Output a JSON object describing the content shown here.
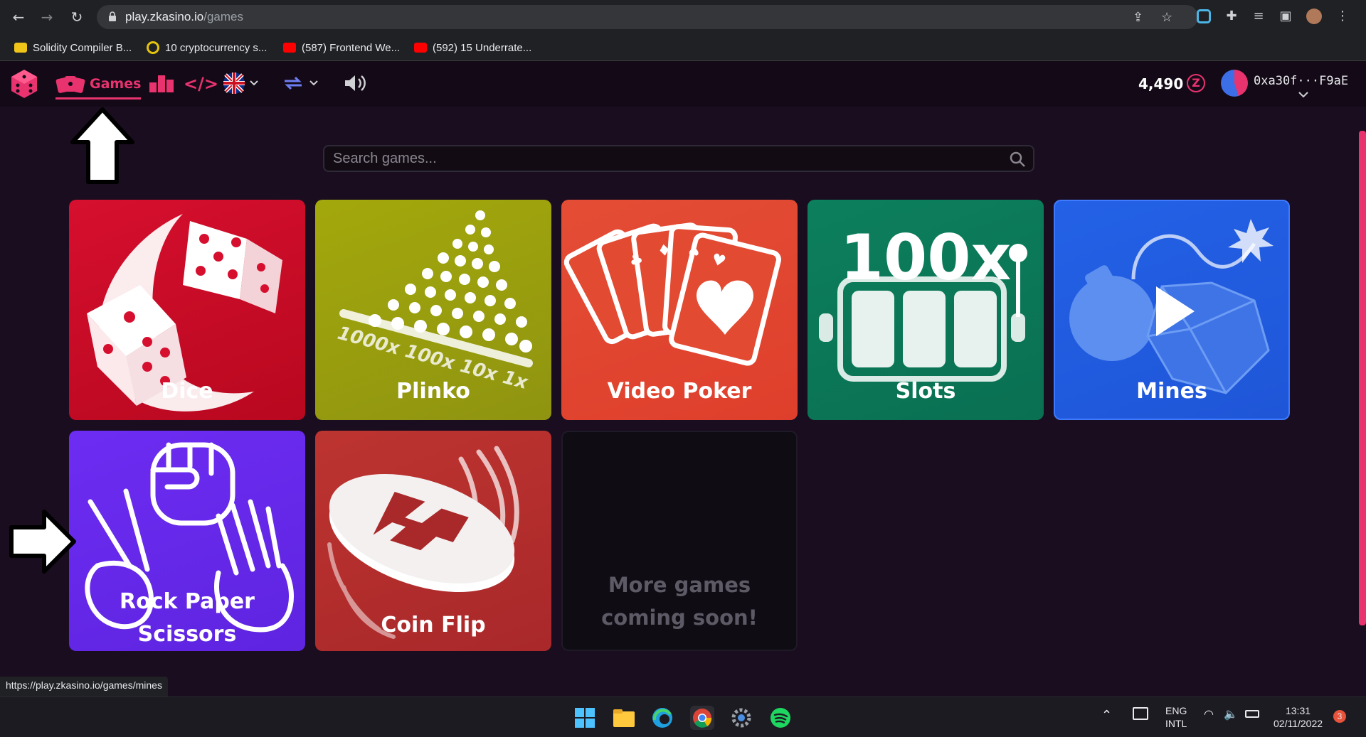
{
  "browser": {
    "url_host": "play.zkasino.io",
    "url_path": "/games",
    "bookmarks": [
      {
        "label": "Solidity Compiler B...",
        "color": "#f0c419"
      },
      {
        "label": "10 cryptocurrency s...",
        "color": "#e5c40c"
      },
      {
        "label": "(587) Frontend We...",
        "color": "#ff0000"
      },
      {
        "label": "(592) 15 Underrate...",
        "color": "#ff0000"
      }
    ],
    "status_url": "https://play.zkasino.io/games/mines"
  },
  "header": {
    "games_label": "Games",
    "balance": "4,490",
    "coin_symbol": "Z",
    "wallet": "0xa30f···F9aE"
  },
  "search": {
    "placeholder": "Search games..."
  },
  "games": [
    {
      "name": "Dice",
      "color": "#c80c2a"
    },
    {
      "name": "Plinko",
      "color": "#9b9f10"
    },
    {
      "name": "Video Poker",
      "color": "#e24a32"
    },
    {
      "name": "Slots",
      "color": "#0c7a58"
    },
    {
      "name": "Mines",
      "color": "#1f5fe0"
    },
    {
      "name_line1": "Rock Paper",
      "name_line2": "Scissors",
      "color": "#6a2cf0"
    },
    {
      "name": "Coin Flip",
      "color": "#b8302e"
    }
  ],
  "coming_soon": {
    "line1": "More games",
    "line2": "coming soon!"
  },
  "plinko_multipliers": "1000x 100x 10x 1x",
  "slots_multiplier": "100x",
  "taskbar": {
    "lang_line1": "ENG",
    "lang_line2": "INTL",
    "time": "13:31",
    "date": "02/11/2022",
    "notifications": "3"
  }
}
